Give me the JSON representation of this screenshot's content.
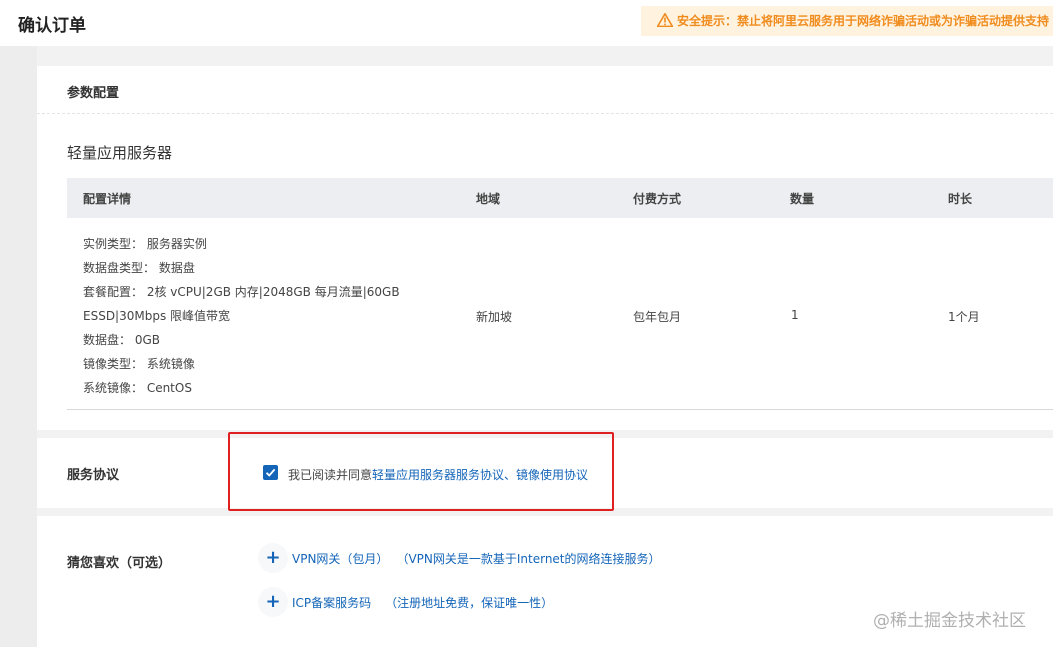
{
  "header": {
    "title": "确认订单",
    "warning": "安全提示：禁止将阿里云服务用于网络诈骗活动或为诈骗活动提供支持",
    "warning_color": "#f08c1e"
  },
  "params": {
    "title": "参数配置",
    "product": "轻量应用服务器",
    "columns": [
      "配置详情",
      "地域",
      "付费方式",
      "数量",
      "时长"
    ],
    "specs": [
      "实例类型：  服务器实例",
      "数据盘类型：  数据盘",
      "套餐配置：  2核 vCPU|2GB 内存|2048GB 每月流量|60GB",
      "ESSD|30Mbps 限峰值带宽",
      "数据盘：  0GB",
      "镜像类型：  系统镜像",
      "系统镜像：  CentOS"
    ],
    "region": "新加坡",
    "billing": "包年包月",
    "quantity": "1",
    "duration": "1个月"
  },
  "agreement": {
    "title": "服务协议",
    "checked": true,
    "prefix": "我已阅读并同意",
    "links": "轻量应用服务器服务协议、镜像使用协议",
    "link_color": "#1465b8"
  },
  "guess": {
    "title": "猜您喜欢（可选）",
    "items": [
      {
        "name": "VPN网关（包月）",
        "desc": "（VPN网关是一款基于Internet的网络连接服务）"
      },
      {
        "name": "ICP备案服务码",
        "desc": "（注册地址免费，保证唯一性）"
      }
    ]
  },
  "watermark": "@稀土掘金技术社区"
}
